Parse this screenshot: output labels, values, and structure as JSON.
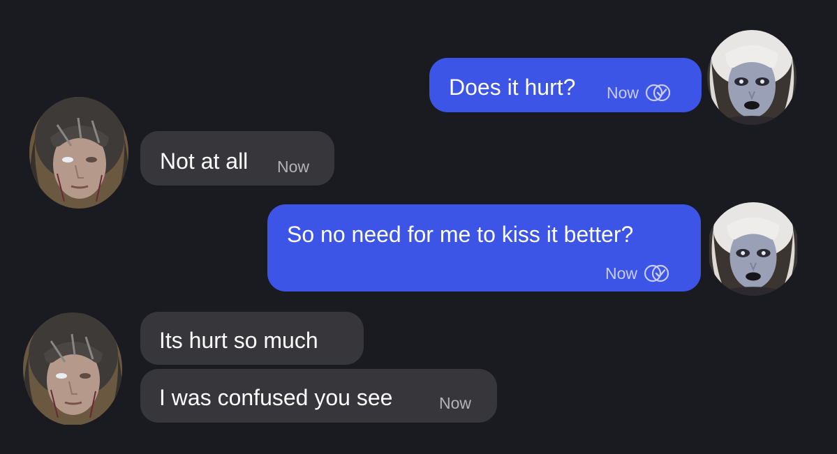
{
  "conversation": {
    "messages": [
      {
        "direction": "outgoing",
        "text": "Does it hurt?",
        "time": "Now",
        "status_icon": "double-check-read-icon"
      },
      {
        "direction": "incoming",
        "text": "Not at all",
        "time": "Now"
      },
      {
        "direction": "outgoing",
        "text": "So no need for me to kiss it better?",
        "time": "Now",
        "status_icon": "double-check-read-icon"
      },
      {
        "direction": "incoming",
        "text": "Its hurt so much",
        "time": ""
      },
      {
        "direction": "incoming",
        "text": "I was confused you see",
        "time": "Now"
      }
    ]
  },
  "participants": {
    "self_avatar": "pale-elf-avatar",
    "contact_avatar": "dark-haired-man-avatar"
  },
  "colors": {
    "background": "#1a1b21",
    "outgoing_bubble": "#3c55e6",
    "incoming_bubble": "#36363b",
    "text": "#ffffff",
    "outgoing_meta": "#c9cdf6",
    "incoming_meta": "#b3b3b8"
  }
}
